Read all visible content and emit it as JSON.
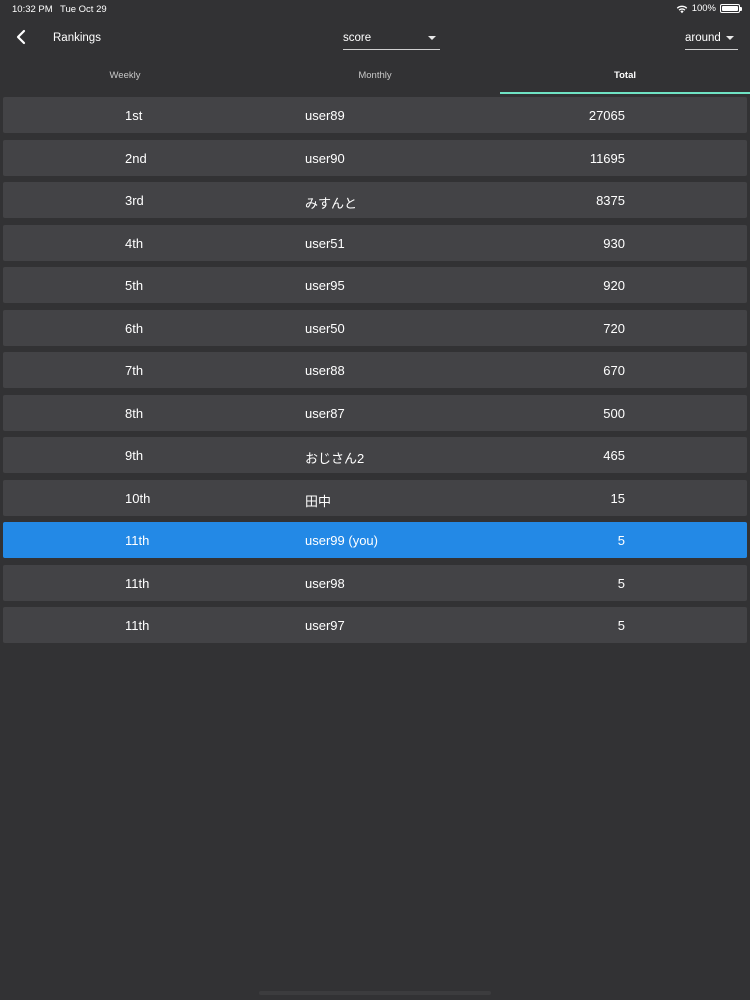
{
  "status_bar": {
    "time": "10:32 PM",
    "date": "Tue Oct 29",
    "battery": "100%"
  },
  "header": {
    "title": "Rankings",
    "metric_select": {
      "value": "score"
    },
    "scope_select": {
      "value": "around"
    }
  },
  "tabs": [
    {
      "label": "Weekly",
      "active": false
    },
    {
      "label": "Monthly",
      "active": false
    },
    {
      "label": "Total",
      "active": true
    }
  ],
  "rankings": [
    {
      "rank": "1st",
      "name": "user89",
      "score": "27065"
    },
    {
      "rank": "2nd",
      "name": "user90",
      "score": "11695"
    },
    {
      "rank": "3rd",
      "name": "みすんと",
      "score": "8375"
    },
    {
      "rank": "4th",
      "name": "user51",
      "score": "930"
    },
    {
      "rank": "5th",
      "name": "user95",
      "score": "920"
    },
    {
      "rank": "6th",
      "name": "user50",
      "score": "720"
    },
    {
      "rank": "7th",
      "name": "user88",
      "score": "670"
    },
    {
      "rank": "8th",
      "name": "user87",
      "score": "500"
    },
    {
      "rank": "9th",
      "name": "おじさん2",
      "score": "465"
    },
    {
      "rank": "10th",
      "name": "田中",
      "score": "15"
    },
    {
      "rank": "11th",
      "name": "user99 (you)",
      "score": "5",
      "is_you": true
    },
    {
      "rank": "11th",
      "name": "user98",
      "score": "5"
    },
    {
      "rank": "11th",
      "name": "user97",
      "score": "5"
    }
  ],
  "colors": {
    "background": "#323234",
    "row": "#434346",
    "highlight": "#2389e6",
    "tab_indicator": "#6fe3c4"
  }
}
